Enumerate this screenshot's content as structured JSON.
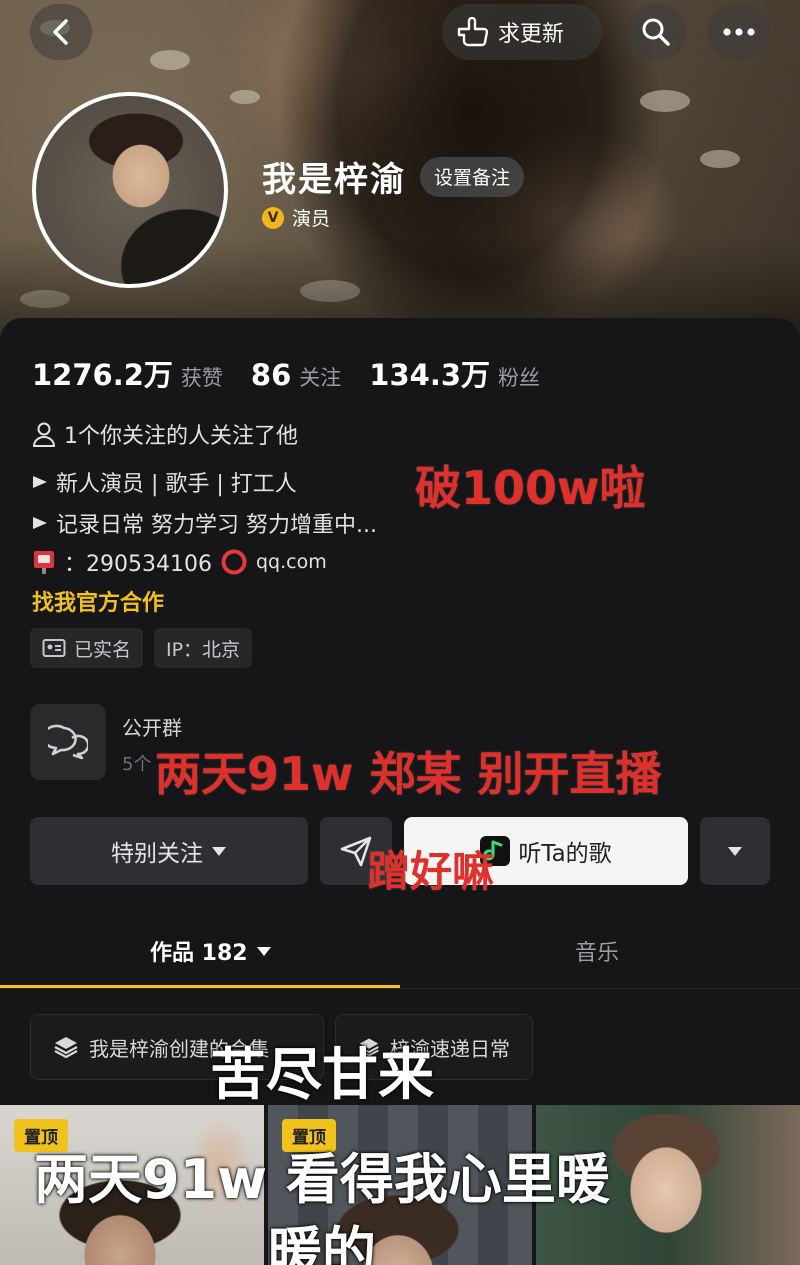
{
  "header": {
    "update_label": "求更新"
  },
  "profile": {
    "name": "我是梓渝",
    "remark_button": "设置备注",
    "verified_badge": "V",
    "role": "演员"
  },
  "stats": [
    {
      "value": "1276.2万",
      "label": "获赞"
    },
    {
      "value": "86",
      "label": "关注"
    },
    {
      "value": "134.3万",
      "label": "粉丝"
    }
  ],
  "bio": {
    "mutual": "1个你关注的人关注了他",
    "line1": "新人演员 | 歌手 | 打工人",
    "line2": "记录日常 努力学习 努力增重中...",
    "email": "：290534106",
    "email_domain": "qq.com",
    "cooperation": "找我官方合作"
  },
  "chips": {
    "realname": "已实名",
    "ip": "IP：北京"
  },
  "group": {
    "title": "公开群",
    "subtitle": "5个"
  },
  "actions": {
    "follow": "特别关注",
    "song": "听Ta的歌"
  },
  "tabs": {
    "works": "作品 182",
    "music": "音乐"
  },
  "collections": [
    {
      "label": "我是梓渝创建的合集"
    },
    {
      "label": "梓渝速递日常"
    }
  ],
  "thumbnails": {
    "pin_label": "置顶"
  },
  "overlay_captions": {
    "c1": "破100w啦",
    "c2": "两天91w 郑某 别开直播",
    "c3": "蹭好嘛",
    "c4": "苦尽甘来",
    "c5": "两天91w 看得我心里暖",
    "c6": "暖的"
  },
  "colors": {
    "accent": "#f1c21b",
    "caption_red": "#e0302c",
    "background": "#161618"
  }
}
